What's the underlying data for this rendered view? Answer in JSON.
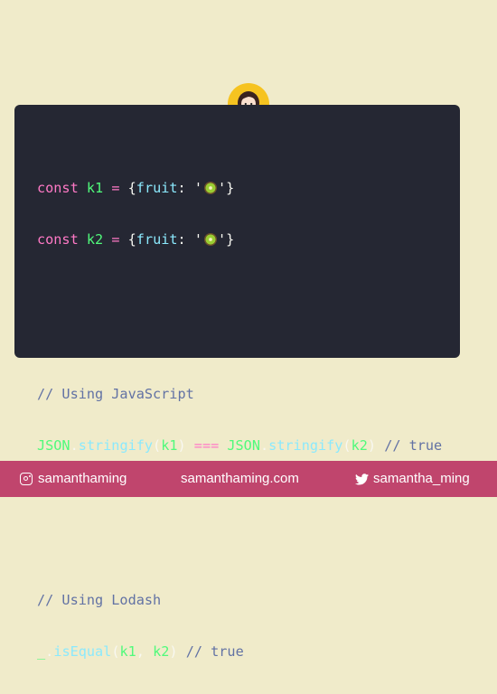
{
  "code": {
    "line1": {
      "keyword": "const",
      "var": "k1",
      "op": "=",
      "open": "{",
      "prop": "fruit",
      "colon": ":",
      "quote_open": "'",
      "quote_close": "'",
      "close": "}"
    },
    "line2": {
      "keyword": "const",
      "var": "k2",
      "op": "=",
      "open": "{",
      "prop": "fruit",
      "colon": ":",
      "quote_open": "'",
      "quote_close": "'",
      "close": "}"
    },
    "comment1": "// Using JavaScript",
    "line3": {
      "obj1": "JSON",
      "dot1": ".",
      "fn1": "stringify",
      "arg1_open": "(",
      "arg1": "k1",
      "arg1_close": ")",
      "op": "===",
      "obj2": "JSON",
      "dot2": ".",
      "fn2": "stringify",
      "arg2_open": "(",
      "arg2": "k2",
      "arg2_close": ")",
      "comment": "// true"
    },
    "comment2": "// Using Lodash",
    "line4": {
      "obj": "_",
      "dot": ".",
      "fn": "isEqual",
      "open": "(",
      "arg1": "k1",
      "comma": ",",
      "arg2": "k2",
      "close": ")",
      "comment": "// true"
    }
  },
  "footer": {
    "instagram": "samanthaming",
    "website": "samanthaming.com",
    "twitter": "samantha_ming"
  },
  "colors": {
    "background": "#f0ebca",
    "card": "#252733",
    "footer": "#c0456d",
    "avatar": "#f6c320"
  }
}
